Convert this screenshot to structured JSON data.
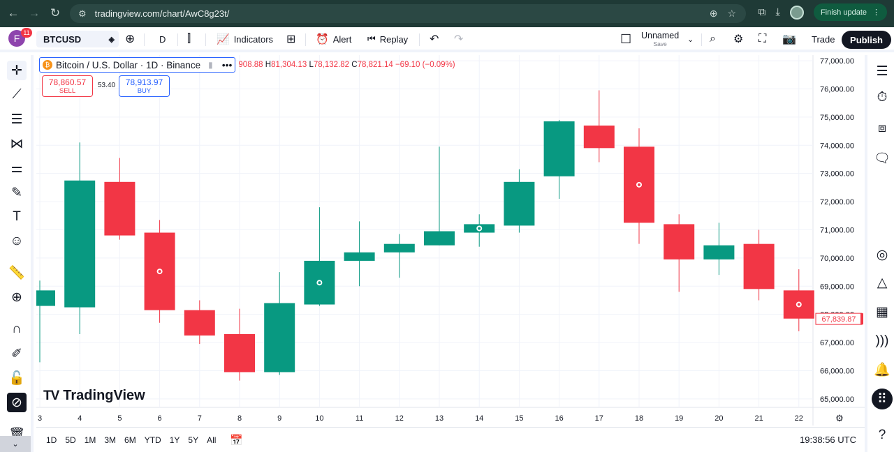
{
  "browser": {
    "url": "tradingview.com/chart/AwC8g23t/",
    "finish_update": "Finish update"
  },
  "toolbar": {
    "avatar_letter": "F",
    "notifications": "11",
    "symbol": "BTCUSD",
    "interval": "D",
    "indicators": "Indicators",
    "alert": "Alert",
    "replay": "Replay",
    "layout_name": "Unnamed",
    "layout_save": "Save",
    "trade": "Trade",
    "publish": "Publish"
  },
  "legend": {
    "title": "Bitcoin / U.S. Dollar · 1D · Binance",
    "coin_glyph": "₿",
    "open_partial": "908.88",
    "high_label": "H",
    "high": "81,304.13",
    "low_label": "L",
    "low": "78,132.82",
    "close_label": "C",
    "close": "78,821.14",
    "change": "−69.10 (−0.09%)",
    "sell_price": "78,860.57",
    "sell_label": "SELL",
    "spread": "53.40",
    "buy_price": "78,913.97",
    "buy_label": "BUY"
  },
  "watermark": "TradingView",
  "bottom": {
    "timeframes": [
      "1D",
      "5D",
      "1M",
      "3M",
      "6M",
      "YTD",
      "1Y",
      "5Y",
      "All"
    ],
    "time": "19:38:56 UTC"
  },
  "colors": {
    "up": "#089981",
    "down": "#f23645",
    "axis_text": "#131722",
    "grid": "#f0f3fa"
  },
  "chart_data": {
    "type": "candlestick",
    "x_labels": [
      "3",
      "4",
      "5",
      "6",
      "7",
      "8",
      "9",
      "10",
      "11",
      "12",
      "13",
      "14",
      "15",
      "16",
      "17",
      "18",
      "19",
      "20",
      "21",
      "22"
    ],
    "y_ticks": [
      "77,000.00",
      "76,000.00",
      "75,000.00",
      "74,000.00",
      "73,000.00",
      "72,000.00",
      "71,000.00",
      "70,000.00",
      "69,000.00",
      "68,000.00",
      "67,000.00",
      "66,000.00",
      "65,000.00"
    ],
    "ylim": [
      64700,
      77200
    ],
    "last_price_label": "67,839.87",
    "last_price": 67839.87,
    "candles": [
      {
        "x": "3",
        "o": 68300,
        "h": 69200,
        "l": 66300,
        "c": 68850
      },
      {
        "x": "4",
        "o": 68250,
        "h": 74100,
        "l": 67300,
        "c": 72750
      },
      {
        "x": "5",
        "o": 72700,
        "h": 73550,
        "l": 70650,
        "c": 70800,
        "marker": false
      },
      {
        "x": "6",
        "o": 70900,
        "h": 71350,
        "l": 67700,
        "c": 68150,
        "marker": true
      },
      {
        "x": "7",
        "o": 68150,
        "h": 68500,
        "l": 66950,
        "c": 67250
      },
      {
        "x": "8",
        "o": 67300,
        "h": 68200,
        "l": 65650,
        "c": 65950
      },
      {
        "x": "9",
        "o": 65950,
        "h": 69500,
        "l": 65850,
        "c": 68400
      },
      {
        "x": "10",
        "o": 68350,
        "h": 71800,
        "l": 68300,
        "c": 69900,
        "marker": true
      },
      {
        "x": "11",
        "o": 69900,
        "h": 71300,
        "l": 69000,
        "c": 70200
      },
      {
        "x": "12",
        "o": 70200,
        "h": 70850,
        "l": 69300,
        "c": 70500
      },
      {
        "x": "13",
        "o": 70450,
        "h": 73950,
        "l": 70450,
        "c": 70950
      },
      {
        "x": "14",
        "o": 70900,
        "h": 71550,
        "l": 70400,
        "c": 71200,
        "marker": true
      },
      {
        "x": "15",
        "o": 71150,
        "h": 73150,
        "l": 70900,
        "c": 72700
      },
      {
        "x": "16",
        "o": 72900,
        "h": 74900,
        "l": 72100,
        "c": 74850
      },
      {
        "x": "17",
        "o": 74700,
        "h": 75950,
        "l": 73400,
        "c": 73900
      },
      {
        "x": "18",
        "o": 73950,
        "h": 74600,
        "l": 70500,
        "c": 71250,
        "marker": true
      },
      {
        "x": "19",
        "o": 71200,
        "h": 71550,
        "l": 68800,
        "c": 69950
      },
      {
        "x": "20",
        "o": 69950,
        "h": 71250,
        "l": 69400,
        "c": 70450
      },
      {
        "x": "21",
        "o": 70500,
        "h": 71000,
        "l": 68500,
        "c": 68900
      },
      {
        "x": "22",
        "o": 68850,
        "h": 69600,
        "l": 67400,
        "c": 67850,
        "marker": true
      }
    ]
  }
}
